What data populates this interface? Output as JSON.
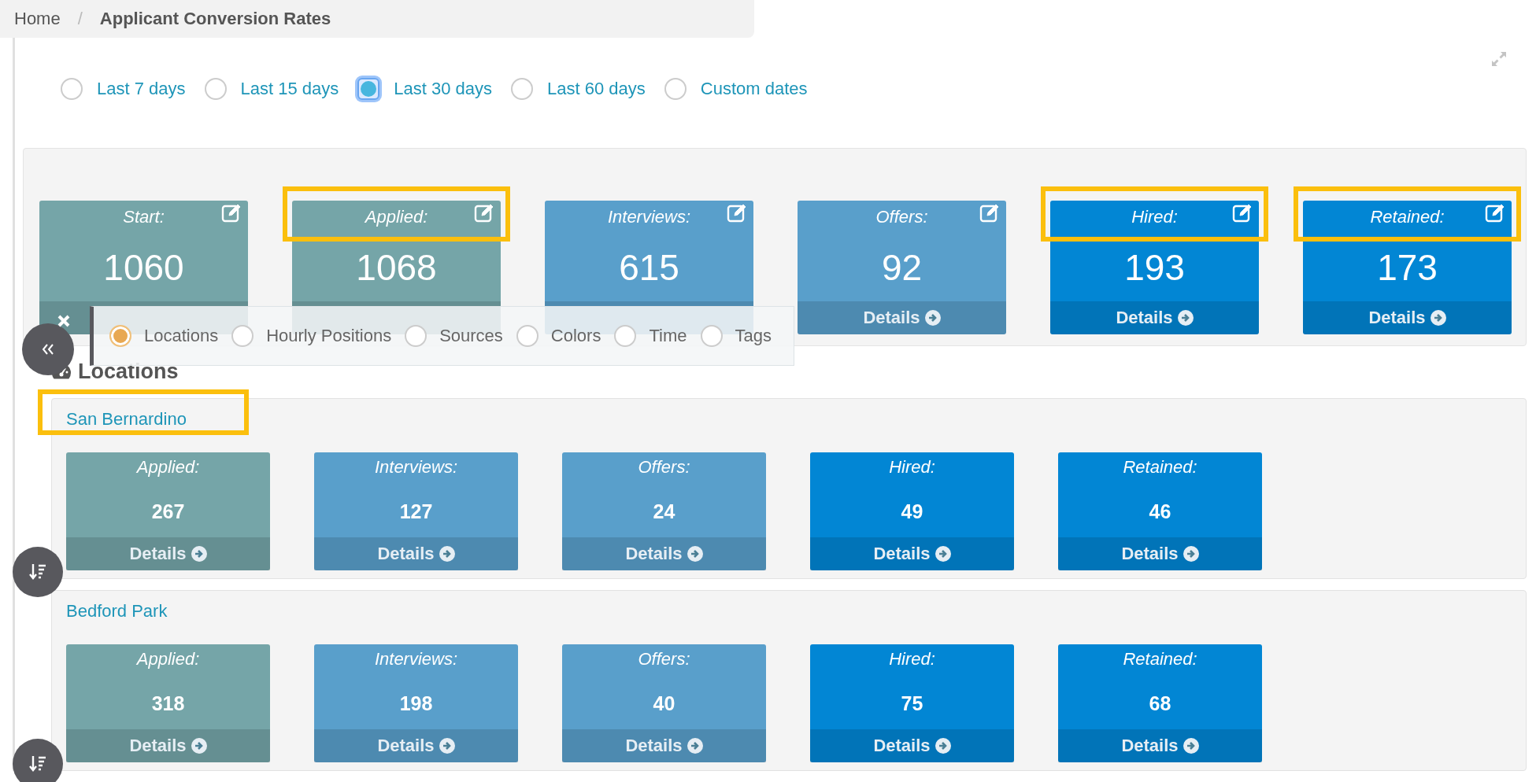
{
  "breadcrumb": {
    "home": "Home",
    "separator": "/",
    "current": "Applicant Conversion Rates"
  },
  "date_ranges": [
    {
      "label": "Last 7 days",
      "selected": false
    },
    {
      "label": "Last 15 days",
      "selected": false
    },
    {
      "label": "Last 30 days",
      "selected": true
    },
    {
      "label": "Last 60 days",
      "selected": false
    },
    {
      "label": "Custom dates",
      "selected": false
    }
  ],
  "summary_cards": [
    {
      "label": "Start:",
      "value": "1060",
      "color": "#75a5a8",
      "highlighted": false
    },
    {
      "label": "Applied:",
      "value": "1068",
      "color": "#75a5a8",
      "highlighted": true
    },
    {
      "label": "Interviews:",
      "value": "615",
      "color": "#599fcb",
      "highlighted": false
    },
    {
      "label": "Offers:",
      "value": "92",
      "details": "Details",
      "color": "#599fcb",
      "highlighted": false
    },
    {
      "label": "Hired:",
      "value": "193",
      "details": "Details",
      "color": "#0286d4",
      "highlighted": true
    },
    {
      "label": "Retained:",
      "value": "173",
      "details": "Details",
      "color": "#0286d4",
      "highlighted": true
    }
  ],
  "group_by": [
    {
      "label": "Locations",
      "selected": true
    },
    {
      "label": "Hourly Positions",
      "selected": false
    },
    {
      "label": "Sources",
      "selected": false
    },
    {
      "label": "Colors",
      "selected": false
    },
    {
      "label": "Time",
      "selected": false
    },
    {
      "label": "Tags",
      "selected": false
    }
  ],
  "section_title": "Locations",
  "locations": [
    {
      "name": "San Bernardino",
      "highlighted": true,
      "cards": [
        {
          "label": "Applied:",
          "value": "267",
          "details": "Details",
          "color": "#75a5a8"
        },
        {
          "label": "Interviews:",
          "value": "127",
          "details": "Details",
          "color": "#599fcb"
        },
        {
          "label": "Offers:",
          "value": "24",
          "details": "Details",
          "color": "#599fcb"
        },
        {
          "label": "Hired:",
          "value": "49",
          "details": "Details",
          "color": "#0286d4"
        },
        {
          "label": "Retained:",
          "value": "46",
          "details": "Details",
          "color": "#0286d4"
        }
      ]
    },
    {
      "name": "Bedford Park",
      "highlighted": false,
      "cards": [
        {
          "label": "Applied:",
          "value": "318",
          "details": "Details",
          "color": "#75a5a8"
        },
        {
          "label": "Interviews:",
          "value": "198",
          "details": "Details",
          "color": "#599fcb"
        },
        {
          "label": "Offers:",
          "value": "40",
          "details": "Details",
          "color": "#599fcb"
        },
        {
          "label": "Hired:",
          "value": "75",
          "details": "Details",
          "color": "#0286d4"
        },
        {
          "label": "Retained:",
          "value": "68",
          "details": "Details",
          "color": "#0286d4"
        }
      ]
    }
  ]
}
